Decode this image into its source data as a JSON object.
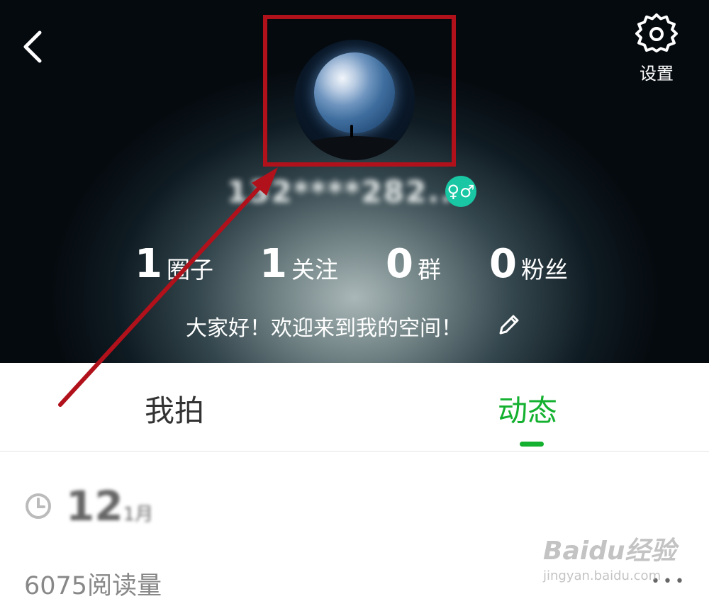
{
  "header": {
    "settings_label": "设置",
    "username": "132****282..",
    "gender_badge": "♀♂",
    "bio": "大家好！欢迎来到我的空间！"
  },
  "stats": [
    {
      "value": "1",
      "label": "圈子"
    },
    {
      "value": "1",
      "label": "关注"
    },
    {
      "value": "0",
      "label": "群"
    },
    {
      "value": "0",
      "label": "粉丝"
    }
  ],
  "tabs": [
    {
      "label": "我拍",
      "active": false
    },
    {
      "label": "动态",
      "active": true
    }
  ],
  "post": {
    "day": "12",
    "month": "1月",
    "reads": "6075阅读量",
    "more": "•••"
  },
  "watermark": {
    "main": "Baidu经验",
    "sub": "jingyan.baidu.com"
  },
  "colors": {
    "accent": "#13b12f",
    "annotation": "#b1111b",
    "badge": "#19c7a4"
  }
}
